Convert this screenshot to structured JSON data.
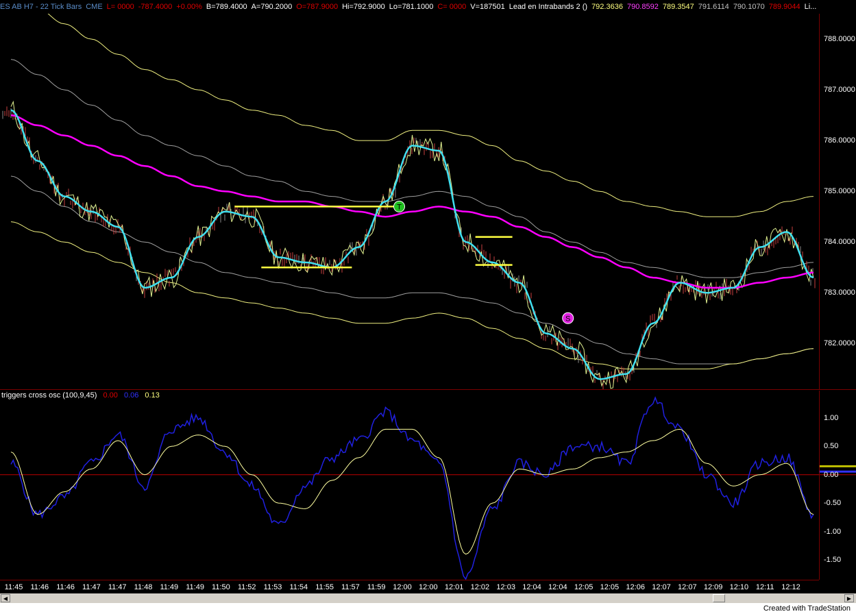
{
  "header": [
    {
      "text": "ES AB H7 - 22 Tick Bars",
      "color": "#5a8cc8"
    },
    {
      "text": "CME",
      "color": "#5a8cc8"
    },
    {
      "text": "L= 0000",
      "color": "#e00000"
    },
    {
      "text": "-787.4000",
      "color": "#e00000"
    },
    {
      "text": "+0.00%",
      "color": "#e00000"
    },
    {
      "text": "B=789.4000",
      "color": "#ffffff"
    },
    {
      "text": "A=790.2000",
      "color": "#ffffff"
    },
    {
      "text": "O=787.9000",
      "color": "#e00000"
    },
    {
      "text": "Hi=792.9000",
      "color": "#ffffff"
    },
    {
      "text": "Lo=781.1000",
      "color": "#ffffff"
    },
    {
      "text": "C= 0000",
      "color": "#e00000"
    },
    {
      "text": "V=187501",
      "color": "#ffffff"
    },
    {
      "text": "Lead en Intrabands 2 ()",
      "color": "#ffffff"
    },
    {
      "text": "792.3636",
      "color": "#ffff80"
    },
    {
      "text": "790.8592",
      "color": "#ff40ff"
    },
    {
      "text": "789.3547",
      "color": "#ffff80"
    },
    {
      "text": "791.6114",
      "color": "#c0c0c0"
    },
    {
      "text": "790.1070",
      "color": "#c0c0c0"
    },
    {
      "text": "789.9044",
      "color": "#e00000"
    },
    {
      "text": "Li...",
      "color": "#ffffff"
    }
  ],
  "oscillator": {
    "title": "triggers cross osc (100,9,45)",
    "values": [
      {
        "text": "0.00",
        "color": "#e00000"
      },
      {
        "text": "0.06",
        "color": "#3030ff"
      },
      {
        "text": "0.13",
        "color": "#ffff80"
      }
    ]
  },
  "price_axis": [
    "788.0000",
    "787.0000",
    "786.0000",
    "785.0000",
    "784.0000",
    "783.0000",
    "782.0000"
  ],
  "osc_axis": [
    "1.00",
    "0.50",
    "0.00",
    "-0.50",
    "-1.00",
    "-1.50"
  ],
  "time_axis": [
    "11:45",
    "11:46",
    "11:46",
    "11:47",
    "11:47",
    "11:48",
    "11:49",
    "11:49",
    "11:50",
    "11:52",
    "11:53",
    "11:54",
    "11:55",
    "11:57",
    "11:59",
    "12:00",
    "12:00",
    "12:01",
    "12:02",
    "12:03",
    "12:04",
    "12:04",
    "12:05",
    "12:05",
    "12:06",
    "12:07",
    "12:07",
    "12:09",
    "12:10",
    "12:11",
    "12:12"
  ],
  "footer": {
    "text": "Created with TradeStation"
  },
  "colors": {
    "upper_band": "#f0f080",
    "mid_band": "#a0a0a0",
    "pink_ma": "#ff00ff",
    "cyan_ma": "#40e0f0",
    "price_bars": "#c0c0c0",
    "levels": "#ffff40",
    "osc_blue": "#2020e0",
    "osc_yellow": "#ffffa0",
    "zero_line": "#c00000"
  },
  "chart_data": {
    "type": "line",
    "title": "ES AB H7 - 22 Tick Bars",
    "price_ylim": [
      781.1,
      788.5
    ],
    "osc_ylim": [
      -1.85,
      1.3
    ],
    "x": [
      "11:45",
      "11:46",
      "11:46",
      "11:47",
      "11:47",
      "11:48",
      "11:49",
      "11:49",
      "11:50",
      "11:52",
      "11:53",
      "11:54",
      "11:55",
      "11:57",
      "11:59",
      "12:00",
      "12:00",
      "12:01",
      "12:02",
      "12:03",
      "12:04",
      "12:04",
      "12:05",
      "12:05",
      "12:06",
      "12:07",
      "12:07",
      "12:09",
      "12:10",
      "12:11",
      "12:12"
    ],
    "series": [
      {
        "name": "upper_outer",
        "values": [
          788.9,
          788.6,
          788.3,
          788.0,
          787.7,
          787.4,
          787.2,
          787.0,
          786.8,
          786.6,
          786.5,
          786.3,
          786.2,
          786.0,
          786.0,
          786.2,
          786.2,
          786.1,
          785.9,
          785.6,
          785.4,
          785.2,
          785.0,
          784.8,
          784.7,
          784.6,
          784.5,
          784.5,
          784.6,
          784.8,
          784.9
        ]
      },
      {
        "name": "upper_inner",
        "values": [
          787.6,
          787.3,
          787.0,
          786.7,
          786.4,
          786.1,
          785.9,
          785.7,
          785.5,
          785.3,
          785.2,
          785.0,
          784.9,
          784.8,
          784.8,
          784.9,
          785.0,
          784.9,
          784.7,
          784.5,
          784.2,
          784.0,
          783.8,
          783.6,
          783.5,
          783.4,
          783.3,
          783.3,
          783.4,
          783.5,
          783.6
        ]
      },
      {
        "name": "pink_ma",
        "values": [
          786.5,
          786.3,
          786.1,
          785.9,
          785.7,
          785.5,
          785.3,
          785.1,
          785.0,
          784.9,
          784.8,
          784.8,
          784.7,
          784.6,
          784.5,
          784.6,
          784.7,
          784.6,
          784.5,
          784.3,
          784.1,
          783.9,
          783.7,
          783.5,
          783.3,
          783.2,
          783.1,
          783.1,
          783.2,
          783.3,
          783.4
        ]
      },
      {
        "name": "lower_inner",
        "values": [
          785.3,
          785.0,
          784.7,
          784.4,
          784.2,
          784.0,
          783.8,
          783.6,
          783.4,
          783.3,
          783.2,
          783.1,
          783.0,
          782.9,
          782.9,
          783.0,
          783.0,
          782.9,
          782.8,
          782.6,
          782.4,
          782.2,
          782.0,
          781.8,
          781.7,
          781.6,
          781.6,
          781.6,
          781.7,
          781.8,
          781.9
        ]
      },
      {
        "name": "lower_outer",
        "values": [
          784.4,
          784.2,
          784.0,
          783.8,
          783.6,
          783.4,
          783.2,
          783.0,
          782.9,
          782.8,
          782.7,
          782.6,
          782.5,
          782.4,
          782.4,
          782.5,
          782.6,
          782.5,
          782.3,
          782.1,
          781.9,
          781.7,
          781.6,
          781.5,
          781.5,
          781.5,
          781.5,
          781.6,
          781.7,
          781.8,
          781.9
        ]
      },
      {
        "name": "cyan_ma",
        "values": [
          786.6,
          785.6,
          784.9,
          784.6,
          784.3,
          783.1,
          783.3,
          784.1,
          784.6,
          784.5,
          783.7,
          783.6,
          783.5,
          783.9,
          784.8,
          785.9,
          785.8,
          784.0,
          783.6,
          783.2,
          782.2,
          781.9,
          781.3,
          781.4,
          782.4,
          783.2,
          783.0,
          783.1,
          783.9,
          784.2,
          783.3
        ]
      },
      {
        "name": "osc_blue",
        "values": [
          0.2,
          -0.7,
          -0.4,
          0.2,
          0.7,
          -0.2,
          0.8,
          1.0,
          0.4,
          -0.2,
          -0.9,
          -0.2,
          0.3,
          0.6,
          1.1,
          0.6,
          0.2,
          -1.8,
          -0.6,
          0.2,
          0.0,
          0.5,
          0.5,
          0.2,
          1.3,
          0.8,
          0.0,
          -0.5,
          0.2,
          0.3,
          -0.7
        ]
      },
      {
        "name": "osc_yellow",
        "values": [
          0.4,
          -0.7,
          -0.3,
          0.1,
          0.6,
          0.0,
          0.5,
          0.7,
          0.5,
          0.0,
          -0.5,
          -0.6,
          -0.1,
          0.3,
          0.8,
          0.8,
          0.3,
          -1.4,
          -0.5,
          0.1,
          0.0,
          0.1,
          0.3,
          0.4,
          0.6,
          0.8,
          0.2,
          -0.2,
          0.0,
          0.2,
          -0.7
        ]
      }
    ],
    "levels": [
      784.7,
      783.5,
      784.1,
      783.55
    ],
    "markers": [
      {
        "label": "T",
        "x": "11:59",
        "y": 784.7
      },
      {
        "label": "S",
        "x": "12:04",
        "y": 782.5
      }
    ]
  }
}
